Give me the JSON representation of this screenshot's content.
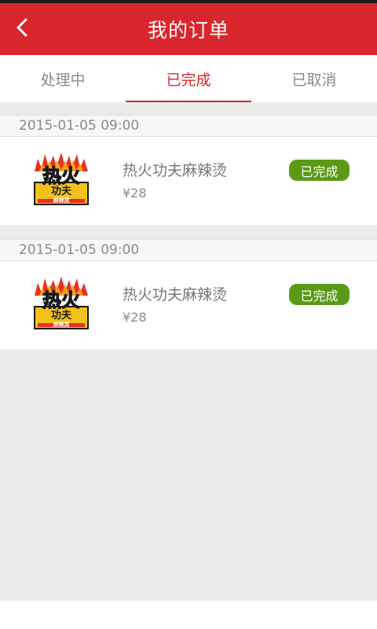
{
  "header": {
    "title": "我的订单",
    "back_icon": "chevron-left-icon"
  },
  "tabs": [
    {
      "label": "处理中",
      "active": false
    },
    {
      "label": "已完成",
      "active": true
    },
    {
      "label": "已取消",
      "active": false
    }
  ],
  "orders": [
    {
      "date": "2015-01-05 09:00",
      "shop_name": "热火功夫麻辣烫",
      "price": "¥28",
      "status": "已完成",
      "logo": {
        "line1": "热火",
        "line2": "功夫",
        "line3": "麻辣烫"
      }
    },
    {
      "date": "2015-01-05 09:00",
      "shop_name": "热火功夫麻辣烫",
      "price": "¥28",
      "status": "已完成",
      "logo": {
        "line1": "热火",
        "line2": "功夫",
        "line3": "麻辣烫"
      }
    }
  ],
  "colors": {
    "accent": "#d9262c",
    "status_done": "#5a9a16"
  }
}
